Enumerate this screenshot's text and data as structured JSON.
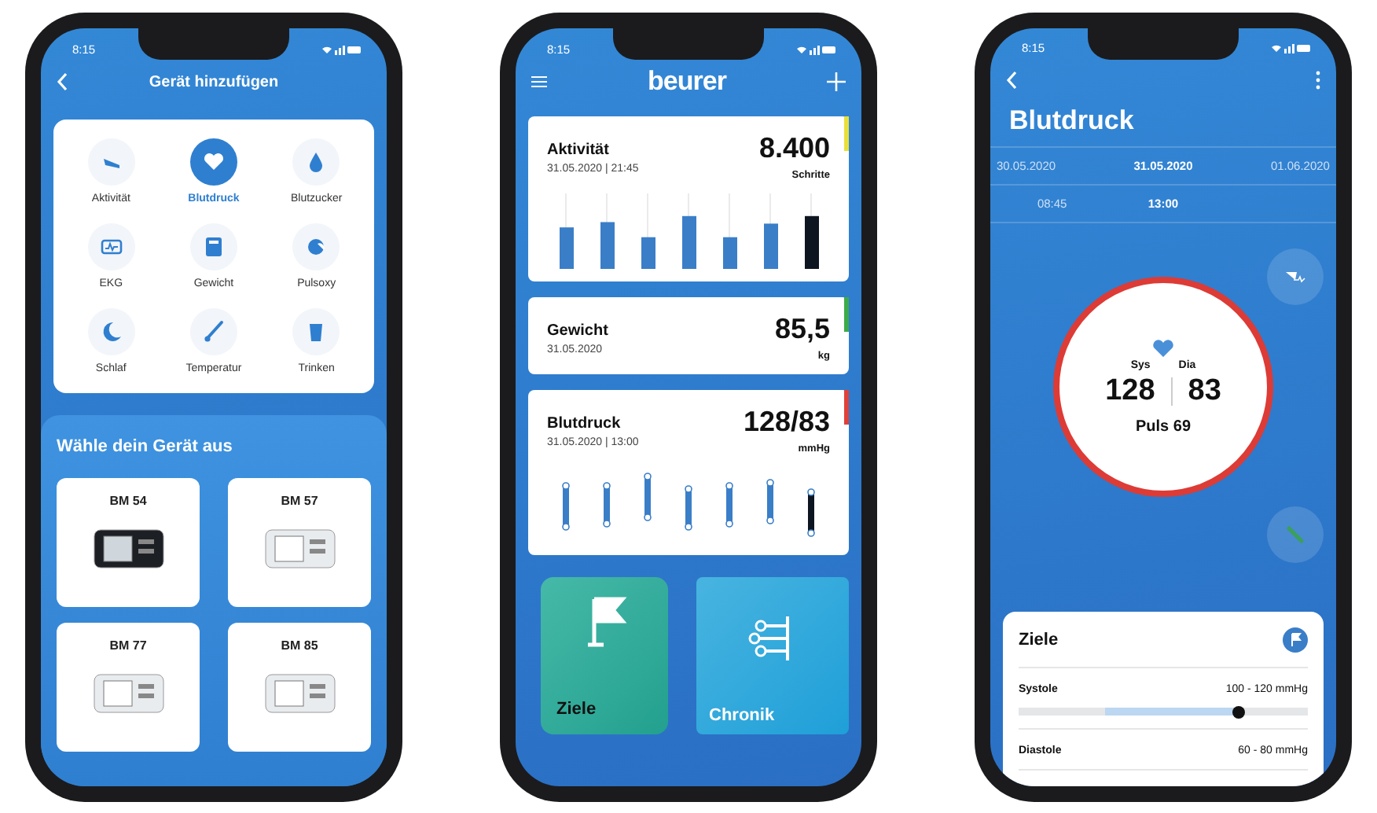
{
  "phones": [
    {
      "kind": "add_device",
      "status": {
        "time": "8:15"
      },
      "title": "Gerät hinzufügen",
      "categories": [
        {
          "label": "Aktivität",
          "selected": false
        },
        {
          "label": "Blutdruck",
          "selected": true
        },
        {
          "label": "Blutzucker",
          "selected": false
        },
        {
          "label": "EKG",
          "selected": false
        },
        {
          "label": "Gewicht",
          "selected": false
        },
        {
          "label": "Pulsoxy",
          "selected": false
        },
        {
          "label": "Schlaf",
          "selected": false
        },
        {
          "label": "Temperatur",
          "selected": false
        },
        {
          "label": "Trinken",
          "selected": false
        }
      ],
      "section_title": "Wähle dein Gerät aus",
      "devices": [
        {
          "name": "BM 54"
        },
        {
          "name": "BM 57"
        },
        {
          "name": "BM 77"
        },
        {
          "name": "BM 85"
        }
      ]
    },
    {
      "kind": "dashboard",
      "status": {
        "time": "8:15"
      },
      "logo": "beurer",
      "cards": [
        {
          "kind": "bars",
          "title": "Aktivität",
          "date": "31.05.2020 | 21:45",
          "value": "8.400",
          "unit": "Schritte",
          "color": "#e8df3a"
        },
        {
          "kind": "plain",
          "title": "Gewicht",
          "date": "31.05.2020",
          "value": "85,5",
          "unit": "kg",
          "color": "#3dab4a"
        },
        {
          "kind": "ranges",
          "title": "Blutdruck",
          "date": "31.05.2020 | 13:00",
          "value": "128/83",
          "unit": "mmHg",
          "color": "#e0403a"
        }
      ],
      "tiles": [
        {
          "kind": "goals",
          "label": "Ziele"
        },
        {
          "kind": "history",
          "label": "Chronik"
        }
      ]
    },
    {
      "kind": "detail",
      "status": {
        "time": "8:15"
      },
      "title": "Blutdruck",
      "dates": [
        {
          "label": "30.05.2020",
          "selected": false
        },
        {
          "label": "31.05.2020",
          "selected": true
        },
        {
          "label": "01.06.2020",
          "selected": false
        }
      ],
      "times": [
        {
          "label": "08:45",
          "selected": false
        },
        {
          "label": "13:00",
          "selected": true
        }
      ],
      "reading": {
        "sys_label": "Sys",
        "dia_label": "Dia",
        "sys": "128",
        "dia": "83",
        "pulse": "Puls 69"
      },
      "goals": {
        "title": "Ziele",
        "rows": [
          {
            "label": "Systole",
            "range": "100 - 120 mmHg",
            "level": 0.76
          },
          {
            "label": "Diastole",
            "range": "60 - 80 mmHg"
          }
        ]
      }
    }
  ]
}
